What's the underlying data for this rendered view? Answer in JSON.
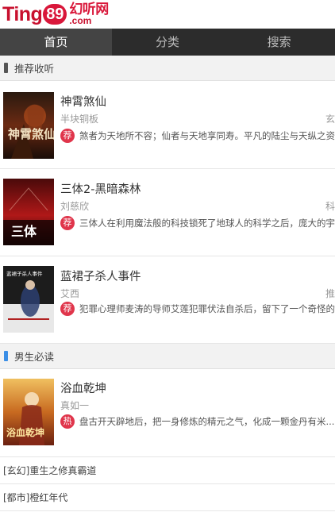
{
  "header": {
    "logo_main": "Ting",
    "logo_number": "89",
    "logo_cn": "幻听网",
    "logo_domain": ".com"
  },
  "nav": {
    "tabs": [
      {
        "label": "首页",
        "active": true
      },
      {
        "label": "分类",
        "active": false
      },
      {
        "label": "搜索",
        "active": false
      }
    ]
  },
  "sections": [
    {
      "title": "推荐收听",
      "bar_color": "#555555",
      "books": [
        {
          "title": "神霄煞仙",
          "author": "半块铜板",
          "genre": "玄",
          "badge": "荐",
          "description": "煞者为天地所不容；仙者与天地享同寿。平凡的陆尘与天纵之资的"
        },
        {
          "title": "三体2-黑暗森林",
          "author": "刘慈欣",
          "genre": "科",
          "badge": "荐",
          "description": "三体人在利用魔法般的科技锁死了地球人的科学之后，庞大的宇宙"
        },
        {
          "title": "蓝裙子杀人事件",
          "author": "艾西",
          "genre": "推",
          "badge": "荐",
          "description": "犯罪心理师麦涛的导师艾莲犯罪伏法自杀后，留下了一个奇怪的遗"
        }
      ]
    },
    {
      "title": "男生必读",
      "bar_color": "#3a8ee6",
      "books": [
        {
          "title": "浴血乾坤",
          "author": "真如一",
          "genre": "",
          "badge": "热",
          "description": "盘古开天辟地后，把一身修炼的精元之气，化成一颗金丹有米..."
        }
      ]
    }
  ],
  "text_list": [
    {
      "category": "[玄幻]",
      "title": "重生之修真霸道"
    },
    {
      "category": "[都市]",
      "title": "橙红年代"
    }
  ],
  "covers": {
    "cover1_text": "神霄煞仙",
    "cover2_text": "三体",
    "cover3_text": "蓝裙子杀人事件",
    "cover4_text": "浴血乾坤"
  },
  "colors": {
    "brand": "#d9173a",
    "nav_bg": "#2c2c2c",
    "nav_active": "#444444",
    "badge": "#e0354b"
  }
}
